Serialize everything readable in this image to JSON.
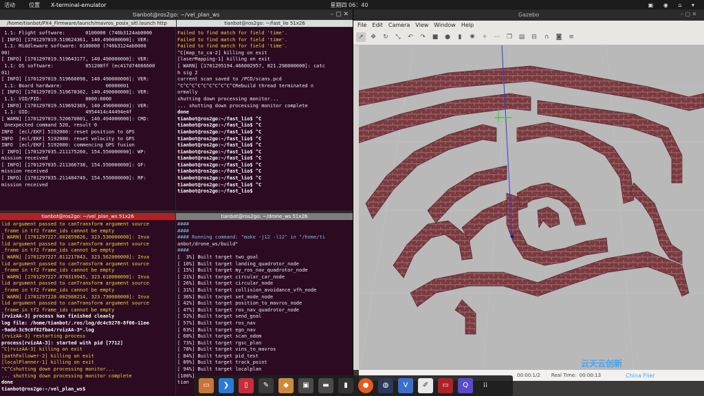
{
  "topbar": {
    "activities": "活动",
    "position": "位置",
    "app": "X-terminal-emulator",
    "clock": "星期四 06：40",
    "indicators": [
      "zh",
      "🔊",
      "⏻"
    ]
  },
  "terminal": {
    "window_title": "tianbot@ros2go: ~/vel_plan_ws",
    "tab_left": "/home/tianbot/PX4_Firmware/launch/mavros_posix_sitl.launch http",
    "tab_right": "tianbot@ros2go: ~/fast_lio",
    "tab_right_size": "51x26",
    "pane_tl": [
      " 1.1: Flight software:       0100000 (746b3124ab0000",
      "[ INFO] [1701297019.519624361, 140.490000000]: VER:",
      " 1.1: Middleware software: 0100000 (746b3124ab0000",
      "00)",
      "[ INFO] [1701297019.519643177, 140.490000000]: VER:",
      " 1.1: OS software:           051208ff (ec417d74666600",
      "01)",
      "[ INFO] [1701297019.519660098, 140.490000000]: VER:",
      " 1.1: Board hardware:               00000001",
      "[ INFO] [1701297019.519678302, 140.490000000]: VER:",
      " 1.1: VID/PID:               0000:0000",
      "[ INFO] [1701297019.519692369, 140.490000000]: VER:",
      " 1.1: UID:                   4954414c44494e4f",
      "[ WARN] [1701297019.520670801, 140.494000000]: CMD:",
      " Unexpected command 520, result 0",
      "INFO  [ecl/EKF] 5192000: reset position to GPS",
      "INFO  [ecl/EKF] 5192000: reset velocity to GPS",
      "INFO  [ecl/EKF] 5192000: commencing GPS fusion",
      "[ INFO] [1701297035.211175260, 154.550000000]: WP:",
      "mission received",
      "[ INFO] [1701297035.211366738, 154.550000000]: GF:",
      "mission received",
      "[ INFO] [1701297035.211484749, 154.550000000]: RP:",
      "mission received"
    ],
    "pane_tr": [
      "Failed to find match for field 'time'.",
      "Failed to find match for field 'time'.",
      "Failed to find match for field 'time'.",
      "^C[map_to_ca-2] killing on exit",
      "[laserMapping-1] killing on exit",
      "[ WARN] [1701295194.466002957, 821.298000000]: catc",
      "h sig 2",
      "current scan saved to /PCD/scans.pcd",
      "^C^C^C^C^C^C^C^C^C^CRebuild thread terminated n",
      "ormally",
      "shutting down processing monitor...",
      "... shutting down processing monitor complete",
      "done",
      "tianbot@ros2go:~/fast_lio$ ^C",
      "tianbot@ros2go:~/fast_lio$ ^C",
      "tianbot@ros2go:~/fast_lio$ ^C",
      "tianbot@ros2go:~/fast_lio$ ^C",
      "tianbot@ros2go:~/fast_lio$ ^C",
      "tianbot@ros2go:~/fast_lio$ ^C",
      "tianbot@ros2go:~/fast_lio$ ^C",
      "tianbot@ros2go:~/fast_lio$ ^C",
      "tianbot@ros2go:~/fast_lio$ ^C",
      "tianbot@ros2go:~/fast_lio$ ^C",
      "tianbot@ros2go:~/fast_lio$ ^C",
      "tianbot@ros2go:~/fast_lio$ "
    ],
    "hdr_bl": "tianbot@ros2go: ~/vel_plan_ws 51x26",
    "hdr_br": "tianbot@ros2go: ~/drone_ws 51x26",
    "pane_bl": [
      "lid argument passed to canTransform argument source",
      "_frame in tf2 frame_ids cannot be empty",
      "[ WARN] [1701297227.602859826, 323.530000000]: Inva",
      "lid argument passed to canTransform argument source",
      "_frame in tf2 frame_ids cannot be empty",
      "[ WARN] [1701297227.811217843, 323.562000000]: Inva",
      "lid argument passed to canTransform argument source",
      "_frame in tf2 frame_ids cannot be empty",
      "[ WARN] [1701297227.878319945, 323.618000000]: Inva",
      "lid argument passed to canTransform argument source",
      "_frame in tf2 frame_ids cannot be empty",
      "[ WARN] [1701297228.002988214, 323.730000000]: Inva",
      "lid argument passed to canTransform argument source",
      "_frame in tf2 frame_ids cannot be empty",
      "[rvizAA-3] process has finished cleanly",
      "log file: /home/tianbot/.ros/log/dc4c9278-8f06-11ee",
      "-9add-3c9c0f82fba4/rvizAA-3*.log",
      "[rvizAA-3] restarting process",
      "process[rvizAA-3]: started with pid [7712]",
      "^C[rvizAA-3] killing on exit",
      "[pathFollower-2] killing on exit",
      "[localPlanner-1] killing on exit",
      "^C^Cshutting down processing monitor...",
      "... shutting down processing monitor complete",
      "done",
      "tianbot@ros2go:~/vel_plan_ws$ "
    ],
    "pane_br": [
      "####",
      "####",
      "#### Running command: \"make -j12 -l12\" in \"/home/ti",
      "anbot/drone_ws/build\"",
      "####",
      "[  3%] Built target two_goal",
      "[ 10%] Built target landing_quadrotor_node",
      "[ 15%] Built target my_ros_nav_quadrotor_node",
      "[ 21%] Built target circular_car_node",
      "[ 26%] Built target circular_node",
      "[ 31%] Built target collision_avoidance_vfh_node",
      "[ 36%] Built target set_mode_node",
      "[ 42%] Built target position_to_mavros_node",
      "[ 47%] Built target ros_nav_quadrotor_node",
      "[ 52%] Built target send_goal",
      "[ 57%] Built target ros_nav",
      "[ 63%] Built target ego_nav",
      "[ 68%] Built target scan_odom",
      "[ 73%] Built target rgsc_plan",
      "[ 78%] Built target vins_to_mavros",
      "[ 84%] Built target pid_test",
      "[ 89%] Built target track_point",
      "[ 94%] Built target localplan",
      "[100%]",
      "tian"
    ]
  },
  "gazebo": {
    "title": "Gazebo",
    "menu": [
      "File",
      "Edit",
      "Camera",
      "View",
      "Window",
      "Help"
    ],
    "tool_icons": [
      "pointer-icon",
      "translate-icon",
      "rotate-icon",
      "scale-icon",
      "undo-icon",
      "redo-icon",
      "box-icon",
      "sphere-icon",
      "cylinder-icon",
      "pointlight-icon",
      "spotlight-icon",
      "dirlight-icon",
      "copy-icon",
      "paste-icon",
      "align-icon",
      "snap-icon",
      "screenshot-icon",
      "record-icon"
    ],
    "status": {
      "real_time_label": "Real Time:",
      "real_time_value": "00:00:13",
      "sim_left": "00:00:1/2"
    }
  },
  "dock": [
    "files-icon",
    "vscode-icon",
    "terminal-red-icon",
    "tool-icon",
    "archive-icon",
    "monitor-icon",
    "nav-icon",
    "term2-icon",
    "firefox-icon",
    "app-icon",
    "vsv-icon",
    "notes-icon",
    "term-active-icon",
    "qt-icon",
    "grid-icon"
  ],
  "watermark": {
    "line1": "云天云创新",
    "line2": "China Flier"
  }
}
